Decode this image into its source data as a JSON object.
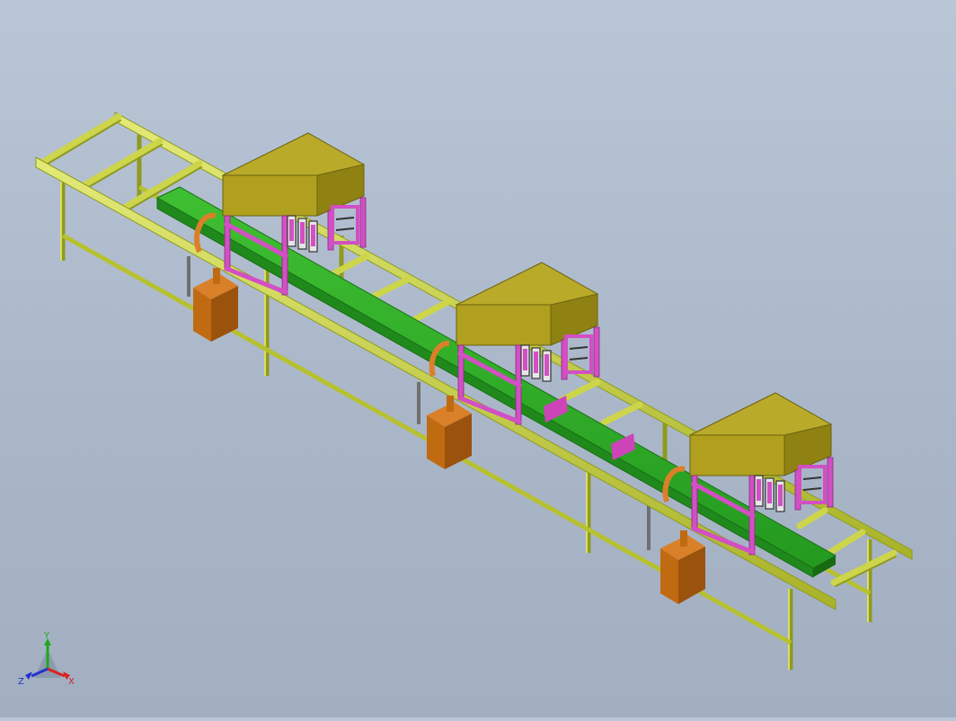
{
  "viewport": {
    "background_top": "#b9c6d6",
    "background_bottom": "#a2afc1"
  },
  "model": {
    "rail_color": "#c8d23a",
    "rail_dark": "#8f9a1e",
    "housing_color": "#b0a01e",
    "frame_color": "#d24fc4",
    "beam_color": "#2aa523",
    "motor_color": "#c06a12",
    "station_count": 3
  },
  "triad": {
    "x_label": "X",
    "y_label": "Y",
    "z_label": "Z",
    "x_color": "#d62222",
    "y_color": "#1fa61f",
    "z_color": "#2233cc"
  }
}
